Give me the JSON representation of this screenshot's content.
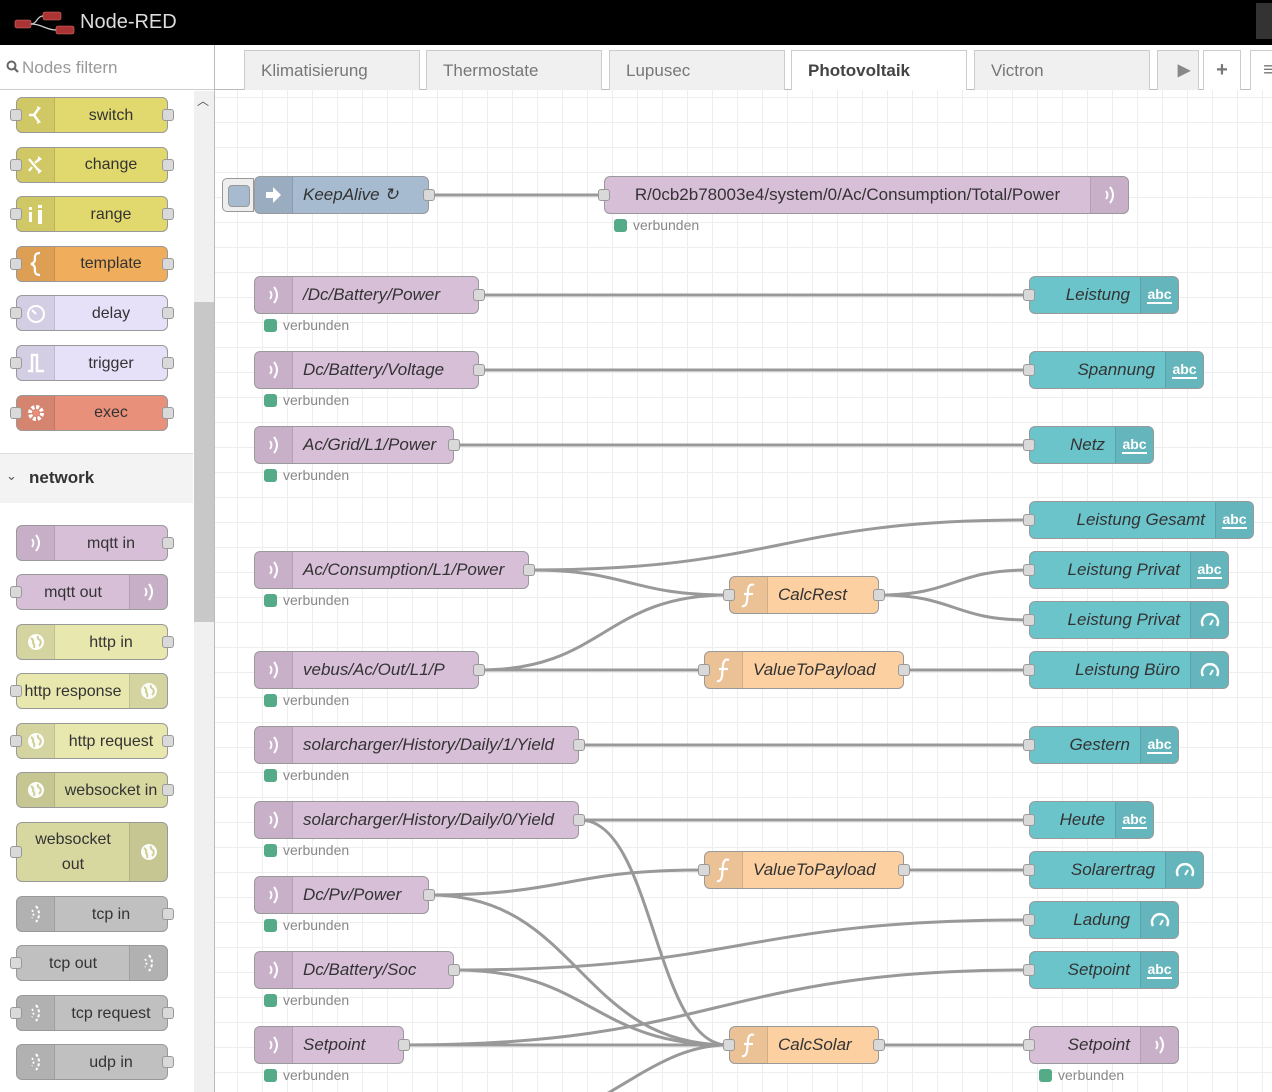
{
  "header": {
    "title": "Node-RED",
    "logo_icon": "node-red-logo"
  },
  "palette": {
    "filter_placeholder": "Nodes filtern",
    "nodes_top": [
      {
        "label": "switch",
        "icon": "switch-icon",
        "color": "#e2d96e"
      },
      {
        "label": "change",
        "icon": "shuffle-icon",
        "color": "#e2d96e"
      },
      {
        "label": "range",
        "icon": "range-icon",
        "color": "#e2d96e"
      },
      {
        "label": "template",
        "icon": "brace-icon",
        "color": "#f0ad5b"
      },
      {
        "label": "delay",
        "icon": "timer-icon",
        "color": "#e6e0f8"
      },
      {
        "label": "trigger",
        "icon": "pulse-icon",
        "color": "#e6e0f8"
      },
      {
        "label": "exec",
        "icon": "gear-icon",
        "color": "#e8907a"
      }
    ],
    "category": {
      "name": "network",
      "expanded": true
    },
    "nodes_network": [
      {
        "label": "mqtt in",
        "icon": "bridge-icon",
        "color": "#d8bfd8",
        "side": "left"
      },
      {
        "label": "mqtt out",
        "icon": "bridge-icon",
        "color": "#d8bfd8",
        "side": "right"
      },
      {
        "label": "http in",
        "icon": "globe-icon",
        "color": "#e7e7ae",
        "side": "left"
      },
      {
        "label": "http response",
        "icon": "globe-icon",
        "color": "#e7e7ae",
        "side": "right"
      },
      {
        "label": "http request",
        "icon": "globe-icon",
        "color": "#e7e7ae",
        "side": "left"
      },
      {
        "label": "websocket in",
        "icon": "globe-icon",
        "color": "#d7d7a0",
        "side": "left"
      },
      {
        "label": "websocket out",
        "icon": "globe-icon",
        "color": "#d7d7a0",
        "side": "right"
      },
      {
        "label": "tcp in",
        "icon": "bridge-dash-icon",
        "color": "#c0c0c0",
        "side": "left"
      },
      {
        "label": "tcp out",
        "icon": "bridge-dash-icon",
        "color": "#c0c0c0",
        "side": "right"
      },
      {
        "label": "tcp request",
        "icon": "bridge-dash-icon",
        "color": "#c0c0c0",
        "side": "left"
      },
      {
        "label": "udp in",
        "icon": "bridge-dash-icon",
        "color": "#c0c0c0",
        "side": "left"
      }
    ]
  },
  "tabs": [
    {
      "label": "Klimatisierung",
      "active": false
    },
    {
      "label": "Thermostate",
      "active": false
    },
    {
      "label": "Lupusec",
      "active": false
    },
    {
      "label": "Photovoltaik",
      "active": true
    },
    {
      "label": "Victron",
      "active": false
    }
  ],
  "tab_buttons": {
    "scroll_right": "▶",
    "add": "+",
    "list": "≡"
  },
  "flow": {
    "status_text": "verbunden",
    "nodes": {
      "keepalive": {
        "label": "KeepAlive ↻",
        "type": "inject"
      },
      "mqtt_out_total": {
        "label": "R/0cb2b78003e4/system/0/Ac/Consumption/Total/Power",
        "type": "mqtt-out",
        "status": "verbunden"
      },
      "in_batt_power": {
        "label": "/Dc/Battery/Power",
        "type": "mqtt-in",
        "status": "verbunden"
      },
      "in_batt_voltage": {
        "label": "Dc/Battery/Voltage",
        "type": "mqtt-in",
        "status": "verbunden"
      },
      "in_grid": {
        "label": "Ac/Grid/L1/Power",
        "type": "mqtt-in",
        "status": "verbunden"
      },
      "in_consumption": {
        "label": "Ac/Consumption/L1/Power",
        "type": "mqtt-in",
        "status": "verbunden"
      },
      "in_vebus": {
        "label": "vebus/Ac/Out/L1/P",
        "type": "mqtt-in",
        "status": "verbunden"
      },
      "in_yield1": {
        "label": "solarcharger/History/Daily/1/Yield",
        "type": "mqtt-in",
        "status": "verbunden"
      },
      "in_yield0": {
        "label": "solarcharger/History/Daily/0/Yield",
        "type": "mqtt-in",
        "status": "verbunden"
      },
      "in_pv": {
        "label": "Dc/Pv/Power",
        "type": "mqtt-in",
        "status": "verbunden"
      },
      "in_soc": {
        "label": "Dc/Battery/Soc",
        "type": "mqtt-in",
        "status": "verbunden"
      },
      "in_setpoint": {
        "label": "Setpoint",
        "type": "mqtt-in",
        "status": "verbunden"
      },
      "f_calcrest": {
        "label": "CalcRest",
        "type": "function"
      },
      "f_vtp1": {
        "label": "ValueToPayload",
        "type": "function"
      },
      "f_vtp2": {
        "label": "ValueToPayload",
        "type": "function"
      },
      "f_calcsolar": {
        "label": "CalcSolar",
        "type": "function"
      },
      "ui_leistung": {
        "label": "Leistung",
        "type": "ui-text"
      },
      "ui_spannung": {
        "label": "Spannung",
        "type": "ui-text"
      },
      "ui_netz": {
        "label": "Netz",
        "type": "ui-text"
      },
      "ui_gesamt": {
        "label": "Leistung Gesamt",
        "type": "ui-text"
      },
      "ui_privat_t": {
        "label": "Leistung Privat",
        "type": "ui-text"
      },
      "ui_privat_g": {
        "label": "Leistung Privat",
        "type": "ui-gauge"
      },
      "ui_buero": {
        "label": "Leistung Büro",
        "type": "ui-gauge"
      },
      "ui_gestern": {
        "label": "Gestern",
        "type": "ui-text"
      },
      "ui_heute": {
        "label": "Heute",
        "type": "ui-text"
      },
      "ui_solarertrag": {
        "label": "Solarertrag",
        "type": "ui-gauge"
      },
      "ui_ladung": {
        "label": "Ladung",
        "type": "ui-gauge"
      },
      "ui_setpoint": {
        "label": "Setpoint",
        "type": "ui-text"
      },
      "out_setpoint": {
        "label": "Setpoint",
        "type": "mqtt-out",
        "status": "verbunden"
      }
    },
    "text_icon_label": "abc",
    "wires": [
      [
        "keepalive",
        "mqtt_out_total"
      ],
      [
        "in_batt_power",
        "ui_leistung"
      ],
      [
        "in_batt_voltage",
        "ui_spannung"
      ],
      [
        "in_grid",
        "ui_netz"
      ],
      [
        "in_consumption",
        "ui_gesamt"
      ],
      [
        "in_consumption",
        "f_calcrest"
      ],
      [
        "in_vebus",
        "f_calcrest"
      ],
      [
        "in_vebus",
        "f_vtp1"
      ],
      [
        "f_calcrest",
        "ui_privat_t"
      ],
      [
        "f_calcrest",
        "ui_privat_g"
      ],
      [
        "f_vtp1",
        "ui_buero"
      ],
      [
        "in_yield1",
        "ui_gestern"
      ],
      [
        "in_yield0",
        "ui_heute"
      ],
      [
        "in_yield0",
        "f_calcsolar"
      ],
      [
        "in_pv",
        "f_vtp2"
      ],
      [
        "in_pv",
        "f_calcsolar"
      ],
      [
        "f_vtp2",
        "ui_solarertrag"
      ],
      [
        "in_soc",
        "ui_ladung"
      ],
      [
        "in_soc",
        "f_calcsolar"
      ],
      [
        "in_setpoint",
        "ui_setpoint"
      ],
      [
        "in_setpoint",
        "f_calcsolar"
      ],
      [
        "f_calcsolar",
        "out_setpoint"
      ]
    ]
  }
}
